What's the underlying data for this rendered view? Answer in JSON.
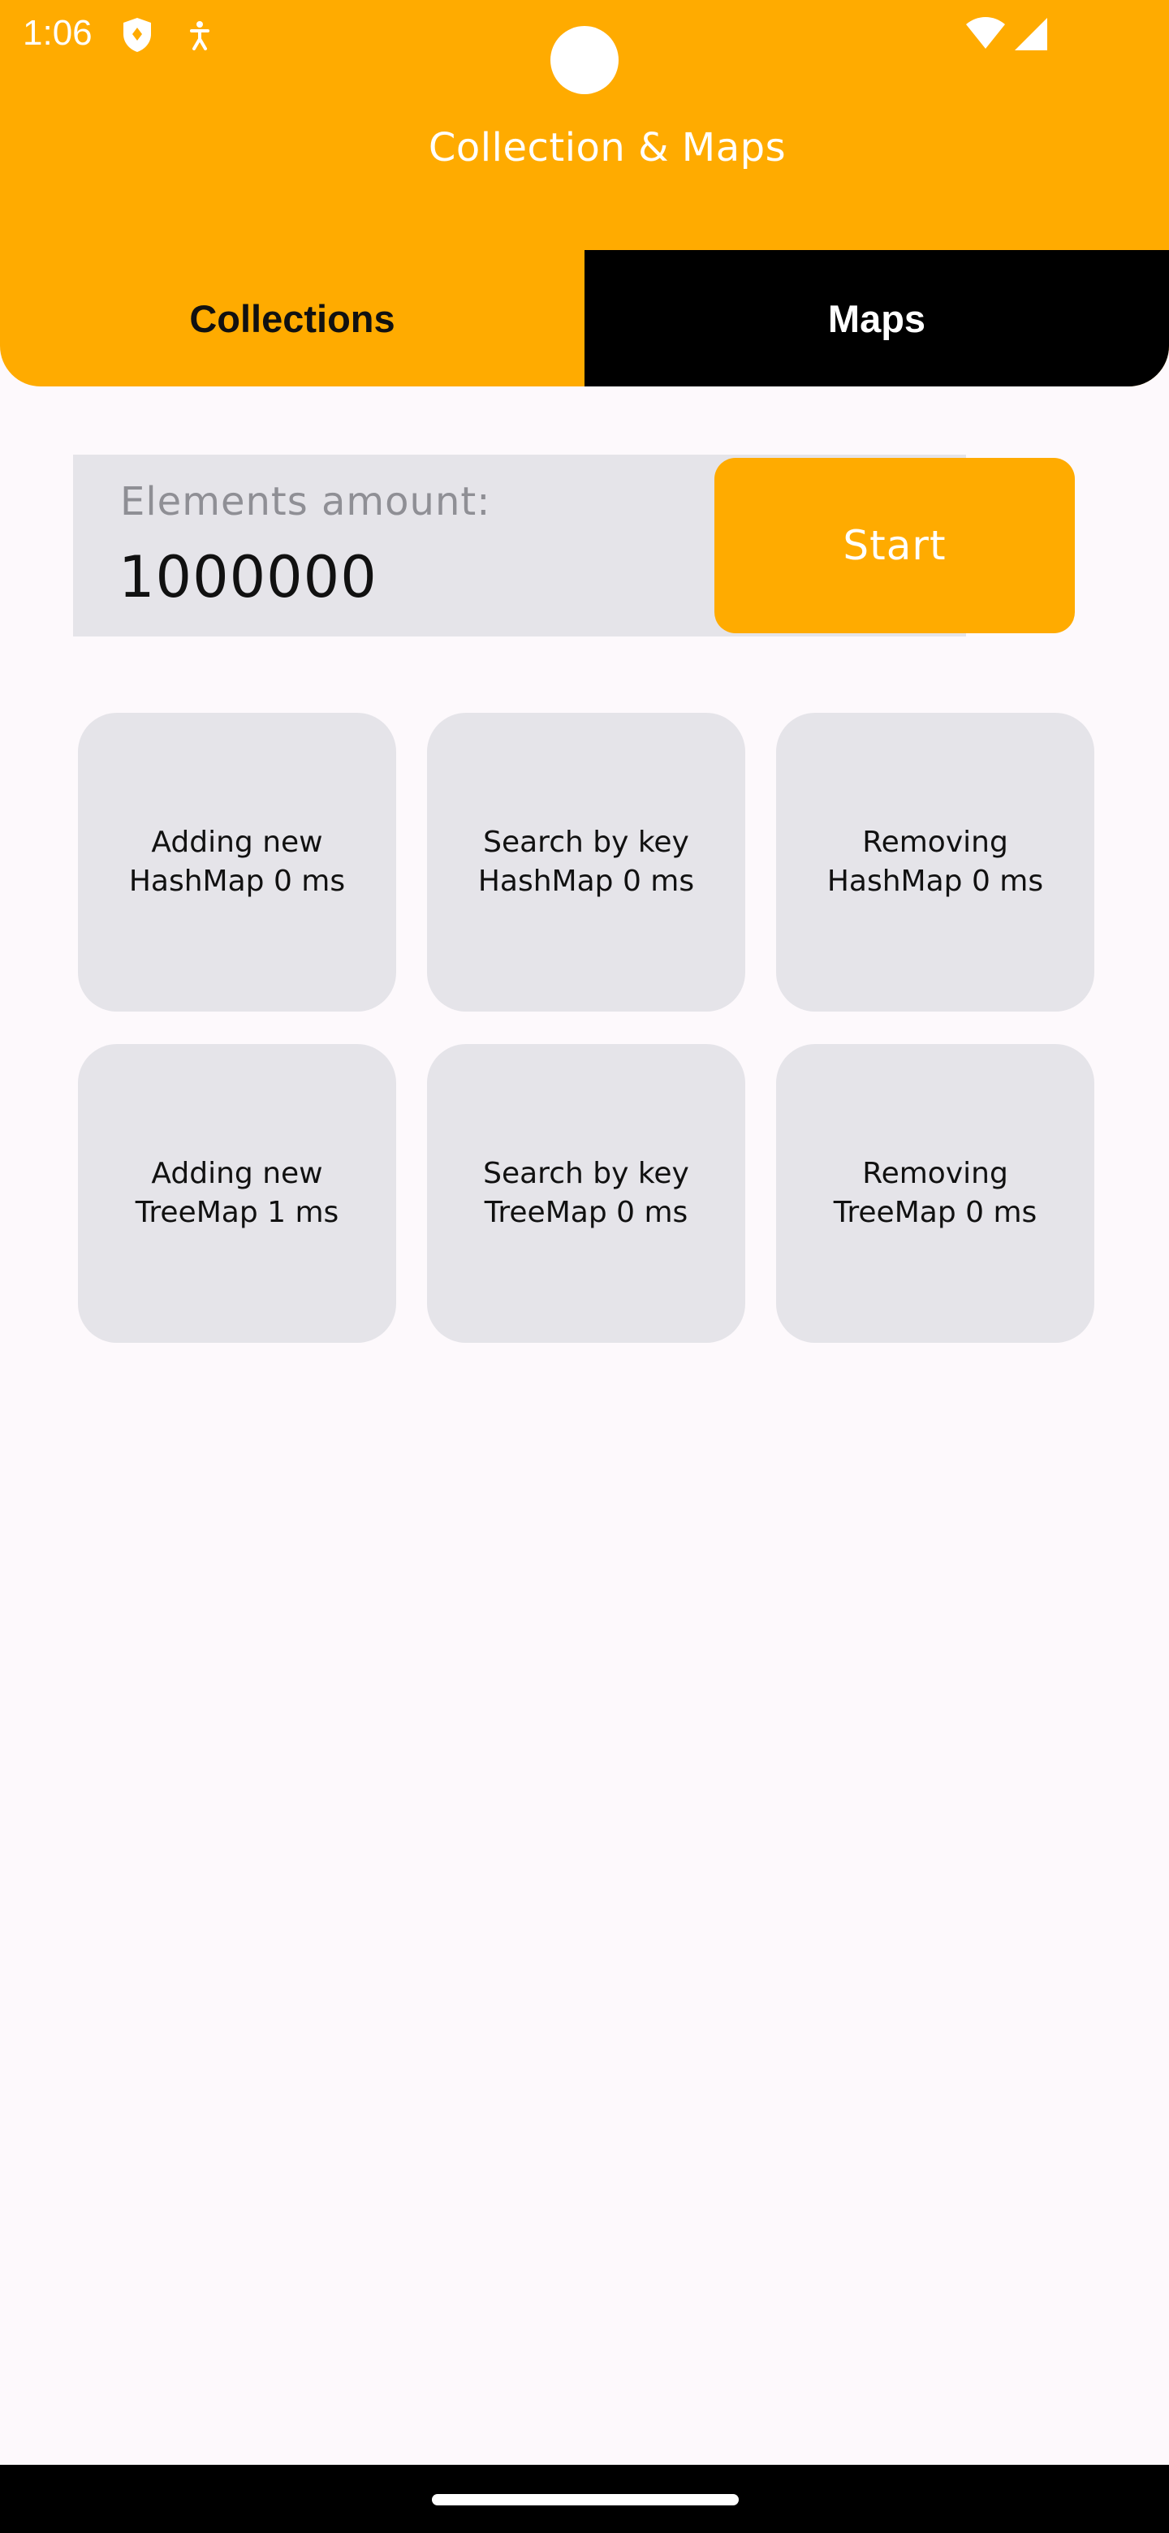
{
  "status_bar": {
    "time": "1:06",
    "icons": [
      "shield-icon",
      "accessibility-icon",
      "wifi-icon",
      "signal-icon"
    ]
  },
  "app": {
    "title": "Collection & Maps",
    "accent_color": "#FFAB00"
  },
  "tabs": [
    {
      "label": "Collections",
      "selected": false
    },
    {
      "label": "Maps",
      "selected": true
    }
  ],
  "form": {
    "label": "Elements amount:",
    "value": "1000000",
    "start_label": "Start"
  },
  "results": [
    {
      "line1": "Adding new",
      "line2": "HashMap 0 ms"
    },
    {
      "line1": "Search by key",
      "line2": "HashMap 0 ms"
    },
    {
      "line1": "Removing",
      "line2": "HashMap 0 ms"
    },
    {
      "line1": "Adding new",
      "line2": "TreeMap 1 ms"
    },
    {
      "line1": "Search by key",
      "line2": "TreeMap 0 ms"
    },
    {
      "line1": "Removing",
      "line2": "TreeMap 0 ms"
    }
  ]
}
